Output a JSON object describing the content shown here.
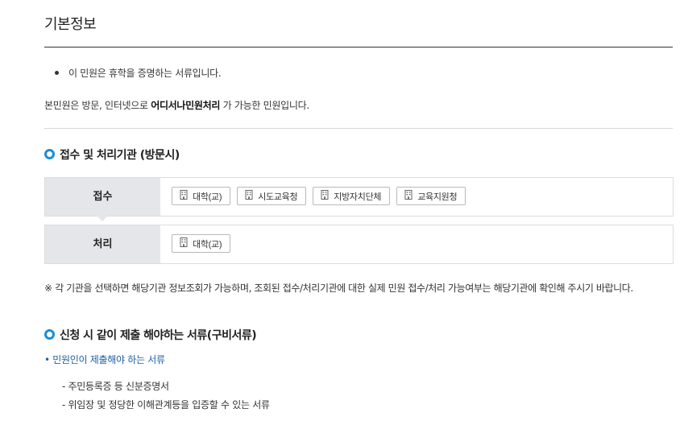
{
  "page": {
    "title": "기본정보"
  },
  "intro": {
    "bullet": "이 민원은 휴학을 증명하는 서류입니다.",
    "desc_prefix": "본민원은 방문, 인터넷으로 ",
    "desc_strong": "어디서나민원처리",
    "desc_suffix": " 가 가능한 민원입니다."
  },
  "agencies": {
    "heading": "접수 및 처리기관 (방문시)",
    "rows": [
      {
        "label": "접수",
        "chips": [
          "대학(교)",
          "시도교육청",
          "지방자치단체",
          "교육지원청"
        ]
      },
      {
        "label": "처리",
        "chips": [
          "대학(교)"
        ]
      }
    ],
    "note": "※ 각 기관을 선택하면 해당기관 정보조회가 가능하며, 조회된 접수/처리기관에 대한 실제 민원 접수/처리 가능여부는 해당기관에 확인해 주시기 바랍니다."
  },
  "documents": {
    "heading": "신청 시 같이 제출 해야하는 서류(구비서류)",
    "sub_bullet": "• 민원인이 제출해야 하는 서류",
    "items": [
      "- 주민등록증 등 신분증명서",
      "- 위임장 및 정당한 이해관계등을 입증할 수 있는 서류"
    ]
  },
  "colors": {
    "accent": "#1a8ed6",
    "link_text": "#1f5fa6",
    "row_header_bg": "#e4e6ea"
  },
  "icons": {
    "chip_icon": "building-icon",
    "heading_icon": "ring-bullet-icon"
  }
}
